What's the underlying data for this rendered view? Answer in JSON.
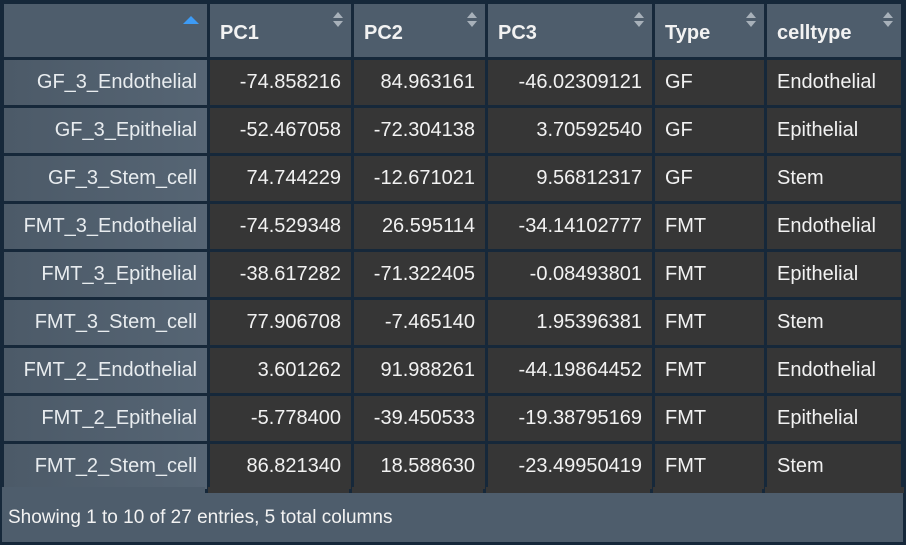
{
  "table": {
    "columns": [
      {
        "label": "",
        "sort": "ascending"
      },
      {
        "label": "PC1",
        "sort": "none"
      },
      {
        "label": "PC2",
        "sort": "none"
      },
      {
        "label": "PC3",
        "sort": "none"
      },
      {
        "label": "Type",
        "sort": "none"
      },
      {
        "label": "celltype",
        "sort": "none"
      }
    ],
    "rows": [
      {
        "name": "GF_3_Endothelial",
        "pc1": "-74.858216",
        "pc2": "84.963161",
        "pc3": "-46.02309121",
        "type": "GF",
        "celltype": "Endothelial"
      },
      {
        "name": "GF_3_Epithelial",
        "pc1": "-52.467058",
        "pc2": "-72.304138",
        "pc3": "3.70592540",
        "type": "GF",
        "celltype": "Epithelial"
      },
      {
        "name": "GF_3_Stem_cell",
        "pc1": "74.744229",
        "pc2": "-12.671021",
        "pc3": "9.56812317",
        "type": "GF",
        "celltype": "Stem"
      },
      {
        "name": "FMT_3_Endothelial",
        "pc1": "-74.529348",
        "pc2": "26.595114",
        "pc3": "-34.14102777",
        "type": "FMT",
        "celltype": "Endothelial"
      },
      {
        "name": "FMT_3_Epithelial",
        "pc1": "-38.617282",
        "pc2": "-71.322405",
        "pc3": "-0.08493801",
        "type": "FMT",
        "celltype": "Epithelial"
      },
      {
        "name": "FMT_3_Stem_cell",
        "pc1": "77.906708",
        "pc2": "-7.465140",
        "pc3": "1.95396381",
        "type": "FMT",
        "celltype": "Stem"
      },
      {
        "name": "FMT_2_Endothelial",
        "pc1": "3.601262",
        "pc2": "91.988261",
        "pc3": "-44.19864452",
        "type": "FMT",
        "celltype": "Endothelial"
      },
      {
        "name": "FMT_2_Epithelial",
        "pc1": "-5.778400",
        "pc2": "-39.450533",
        "pc3": "-19.38795169",
        "type": "FMT",
        "celltype": "Epithelial"
      },
      {
        "name": "FMT_2_Stem_cell",
        "pc1": "86.821340",
        "pc2": "18.588630",
        "pc3": "-23.49950419",
        "type": "FMT",
        "celltype": "Stem"
      }
    ]
  },
  "footer": {
    "info": "Showing 1 to 10 of 27 entries, 5 total columns"
  },
  "colors": {
    "header_bg": "#4e5d6c",
    "cell_bg": "#363636",
    "border": "#16283a",
    "sort_active": "#3d9bf5"
  }
}
